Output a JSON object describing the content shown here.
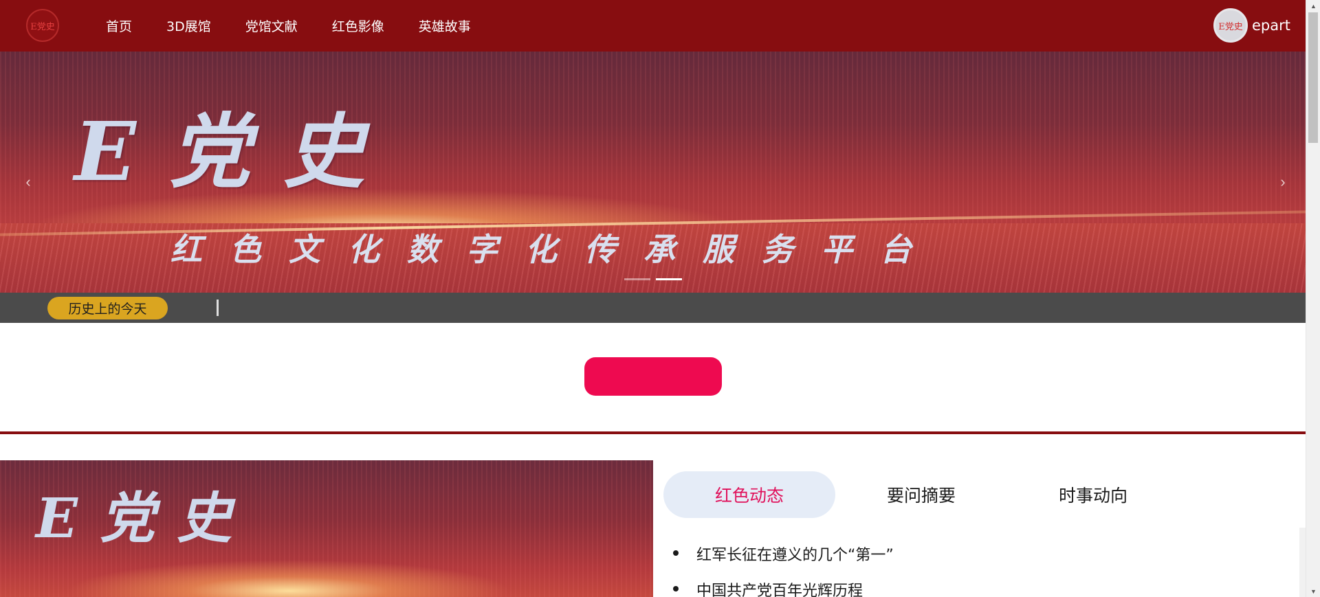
{
  "header": {
    "logo_text": "E党史",
    "nav": [
      "首页",
      "3D展馆",
      "党馆文献",
      "红色影像",
      "英雄故事"
    ],
    "avatar_text": "E党史",
    "username": "epart"
  },
  "banner": {
    "title": "E党史",
    "subtitle": "红色文化数字化传承服务平台",
    "prev_glyph": "‹",
    "next_glyph": "›",
    "slides_count": 2,
    "active_slide": 2
  },
  "ticker": {
    "badge": "历史上的今天"
  },
  "colors": {
    "nav_bg": "#870d10",
    "badge": "#daa520",
    "pink_button": "#ee0a50",
    "active_tab_text": "#e0105a",
    "active_tab_bg": "#e5ecf7"
  },
  "content": {
    "thumb_title": "E党史",
    "tabs": [
      "红色动态",
      "要问摘要",
      "时事动向"
    ],
    "active_tab": "红色动态",
    "news": [
      "红军长征在遵义的几个“第一”",
      "中国共产党百年光辉历程"
    ]
  },
  "scrollbar": {
    "up_glyph": "▲",
    "down_glyph": "▼"
  }
}
